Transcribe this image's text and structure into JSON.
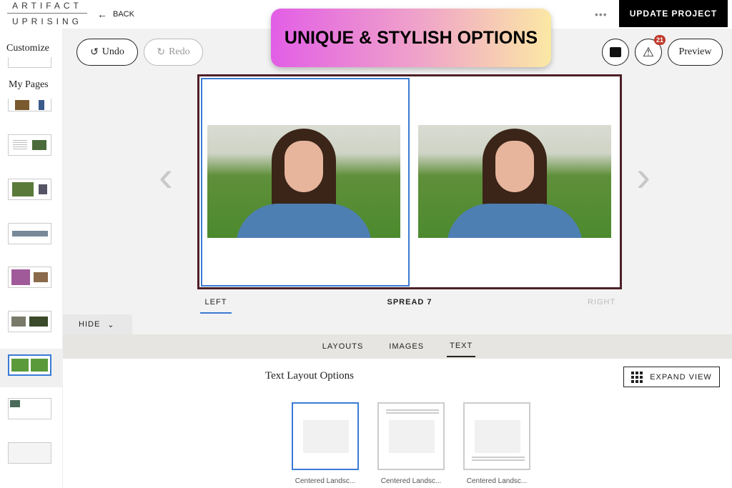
{
  "header": {
    "logo_top": "ARTIFACT",
    "logo_bottom": "UPRISING",
    "back_label": "BACK",
    "more_label": "•••",
    "update_label": "UPDATE PROJECT"
  },
  "sidebar": {
    "customize_label": "Customize",
    "my_pages_label": "My Pages",
    "thumbnail_count": 9,
    "selected_index": 6
  },
  "toolbar": {
    "undo_label": "Undo",
    "redo_label": "Redo",
    "preview_label": "Preview",
    "alerts_count": "21"
  },
  "banner": {
    "text": "UNIQUE & STYLISH OPTIONS"
  },
  "spread": {
    "left_label": "LEFT",
    "title": "SPREAD 7",
    "right_label": "RIGHT"
  },
  "panel": {
    "hide_label": "HIDE",
    "tabs": [
      "LAYOUTS",
      "IMAGES",
      "TEXT"
    ],
    "active_tab": "TEXT",
    "section_title": "Text Layout Options",
    "expand_label": "EXPAND VIEW",
    "options": [
      "Centered Landsc...",
      "Centered Landsc...",
      "Centered Landsc..."
    ]
  },
  "colors": {
    "accent": "#3a7bd5",
    "spread_border": "#4e1f27",
    "badge": "#c0392b"
  }
}
